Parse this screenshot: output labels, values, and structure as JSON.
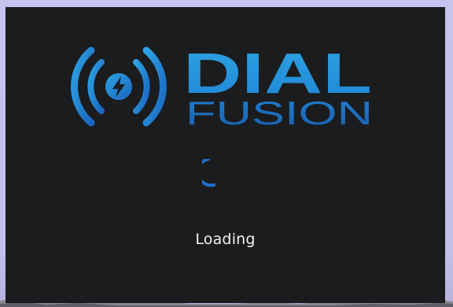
{
  "splash": {
    "brand_line1": "DIAL",
    "brand_line2": "FUSION",
    "status_text": "Loading"
  },
  "icons": {
    "logo_mark": "broadcast-lightning-icon",
    "spinner": "loading-spinner-icon"
  },
  "colors": {
    "window_background": "#1b1c1e",
    "brand_light": "#2ea3e2",
    "brand_dark": "#1a6fc4",
    "spinner": "#1f6fd0",
    "status_text": "#f2f2f2"
  }
}
